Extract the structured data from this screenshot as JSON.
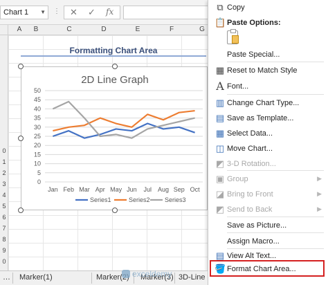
{
  "namebox": {
    "value": "Chart 1"
  },
  "formula_bar": {
    "cancel_glyph": "✕",
    "enter_glyph": "✓",
    "fx_glyph": "fx"
  },
  "columns": [
    "A",
    "B",
    "C",
    "D",
    "E",
    "F",
    "G"
  ],
  "rows": [
    "",
    "",
    "",
    "",
    "",
    "",
    "",
    "",
    "",
    "",
    "0",
    "1",
    "2",
    "3",
    "4",
    "5",
    "6",
    "7",
    "8",
    "9",
    "0"
  ],
  "sheet": {
    "title": "Formatting Chart Area"
  },
  "chart_data": {
    "type": "line",
    "title": "2D Line Graph",
    "categories": [
      "Jan",
      "Feb",
      "Mar",
      "Apr",
      "May",
      "Jun",
      "Jul",
      "Aug",
      "Sep",
      "Oct"
    ],
    "ylim": [
      0,
      50
    ],
    "yticks": [
      0,
      5,
      10,
      15,
      20,
      25,
      30,
      35,
      40,
      45,
      50
    ],
    "grid": true,
    "legend": "bottom",
    "series": [
      {
        "name": "Series1",
        "color": "#4472c4",
        "values": [
          25,
          28,
          24,
          26,
          29,
          28,
          32,
          29,
          30,
          27
        ]
      },
      {
        "name": "Series2",
        "color": "#ed7d31",
        "values": [
          28,
          30,
          31,
          35,
          32,
          30,
          37,
          34,
          38,
          39
        ]
      },
      {
        "name": "Series3",
        "color": "#a5a5a5",
        "values": [
          40,
          44,
          35,
          25,
          26,
          24,
          29,
          31,
          33,
          35
        ]
      }
    ]
  },
  "menu": {
    "copy": "Copy",
    "paste_options": "Paste Options:",
    "paste_special": "Paste Special...",
    "reset_style": "Reset to Match Style",
    "font": "Font...",
    "change_chart_type": "Change Chart Type...",
    "save_template": "Save as Template...",
    "select_data": "Select Data...",
    "move_chart": "Move Chart...",
    "rotation_3d": "3-D Rotation...",
    "group": "Group",
    "bring_front": "Bring to Front",
    "send_back": "Send to Back",
    "save_picture": "Save as Picture...",
    "assign_macro": "Assign Macro...",
    "view_alt_text": "View Alt Text...",
    "format_chart_area": "Format Chart Area..."
  },
  "tabs": [
    "Marker(1)",
    "Marker(2)",
    "Marker(3)",
    "3D-Line"
  ],
  "watermark": "exceldemy"
}
